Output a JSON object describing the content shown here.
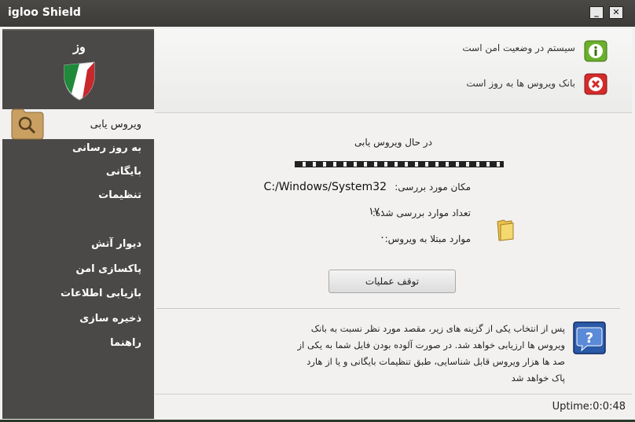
{
  "window": {
    "title": "igloo Shield",
    "minimize_label": "_",
    "close_label": "✕"
  },
  "sidebar": {
    "items": [
      {
        "label": "ویروس یابی",
        "active": true
      },
      {
        "label": "به روز رسانی"
      },
      {
        "label": "بایگانی"
      },
      {
        "label": "تنظیمات"
      },
      {
        "label": "دیوار آتش"
      },
      {
        "label": "پاکسازی امن"
      },
      {
        "label": "بازیابی اطلاعات"
      },
      {
        "label": "ذخیره سازی"
      },
      {
        "label": "راهنما"
      }
    ]
  },
  "status": {
    "system_text": "سیستم در وضعیت امن است",
    "db_text": "بانک ویروس ها به روز است",
    "system_icon": "info-icon",
    "db_icon": "error-icon",
    "system_color": "#6ab02a",
    "db_color": "#d42b2b"
  },
  "scan": {
    "title": "در حال ویروس یابی",
    "location_label": "مکان مورد بررسی:",
    "location_value": "C:/Windows/System32",
    "scanned_label": "تعداد موارد بررسی شده:",
    "scanned_value": "۱۷۰",
    "infected_label": "موارد مبتلا به ویروس:",
    "infected_value": "۰",
    "stop_button": "توقف عملیات"
  },
  "help": {
    "text": "پس از انتخاب یکی از گزینه های زیر، مقصد مورد نظر نسبت به بانک ویروس ها ارزیابی خواهد شد. در صورت آلوده بودن فایل شما به یکی از صد ها هزار ویروس قابل شناسایی، طبق تنظیمات بایگانی و یا از هارد پاک خواهد شد"
  },
  "statusbar": {
    "uptime": "Uptime:0:0:48"
  }
}
